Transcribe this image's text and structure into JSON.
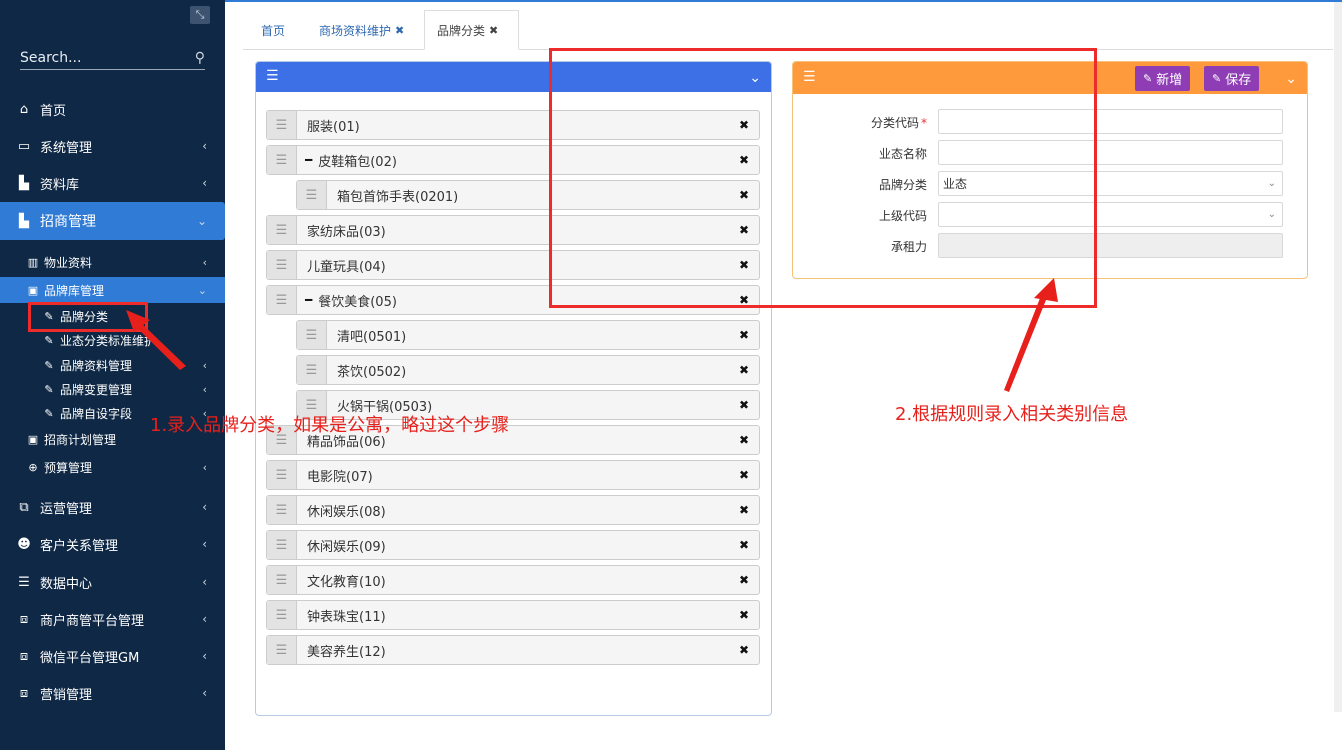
{
  "sidebar": {
    "search_placeholder": "Search...",
    "items": [
      {
        "label": "首页",
        "icon": "home-icon"
      },
      {
        "label": "系统管理",
        "icon": "monitor-icon"
      },
      {
        "label": "资料库",
        "icon": "bar-chart-icon"
      },
      {
        "label": "招商管理",
        "icon": "bar-chart-icon"
      },
      {
        "label": "运营管理",
        "icon": "window-icon"
      },
      {
        "label": "客户关系管理",
        "icon": "user-gear-icon"
      },
      {
        "label": "数据中心",
        "icon": "server-icon"
      },
      {
        "label": "商户商管平台管理",
        "icon": "user-window-icon"
      },
      {
        "label": "微信平台管理GM",
        "icon": "user-window-icon"
      },
      {
        "label": "营销管理",
        "icon": "user-window-icon"
      }
    ],
    "sub_items": [
      {
        "label": "物业资料"
      },
      {
        "label": "品牌库管理"
      },
      {
        "label": "招商计划管理"
      },
      {
        "label": "预算管理"
      }
    ],
    "leaves": [
      {
        "label": "品牌分类"
      },
      {
        "label": "业态分类标准维护"
      },
      {
        "label": "品牌资料管理"
      },
      {
        "label": "品牌变更管理"
      },
      {
        "label": "品牌自设字段"
      }
    ]
  },
  "tabs": [
    {
      "label": "首页"
    },
    {
      "label": "商场资料维护"
    },
    {
      "label": "品牌分类"
    }
  ],
  "tree": [
    {
      "label": "服装(01)"
    },
    {
      "label": "皮鞋箱包(02)"
    },
    {
      "label": "箱包首饰手表(0201)"
    },
    {
      "label": "家纺床品(03)"
    },
    {
      "label": "儿童玩具(04)"
    },
    {
      "label": "餐饮美食(05)"
    },
    {
      "label": "清吧(0501)"
    },
    {
      "label": "茶饮(0502)"
    },
    {
      "label": "火锅干锅(0503)"
    },
    {
      "label": "精品饰品(06)"
    },
    {
      "label": "电影院(07)"
    },
    {
      "label": "休闲娱乐(08)"
    },
    {
      "label": "休闲娱乐(09)"
    },
    {
      "label": "文化教育(10)"
    },
    {
      "label": "钟表珠宝(11)"
    },
    {
      "label": "美容养生(12)"
    }
  ],
  "form": {
    "add_button": "新增",
    "save_button": "保存",
    "fields": [
      {
        "label": "分类代码",
        "value": ""
      },
      {
        "label": "业态名称",
        "value": ""
      },
      {
        "label": "品牌分类",
        "value": "业态"
      },
      {
        "label": "上级代码",
        "value": ""
      },
      {
        "label": "承租力",
        "value": ""
      }
    ]
  },
  "annotations": {
    "step1": "1.录入品牌分类，如果是公寓，略过这个步骤",
    "step2": "2.根据规则录入相关类别信息"
  },
  "colors": {
    "sidebar_bg": "#0f2845",
    "active_blue": "#2f7bd6",
    "left_panel_header": "#3d6fe6",
    "right_panel_header": "#ff9a3c",
    "button_purple": "#8e3db5",
    "annotation_red": "#ee2b2b"
  }
}
